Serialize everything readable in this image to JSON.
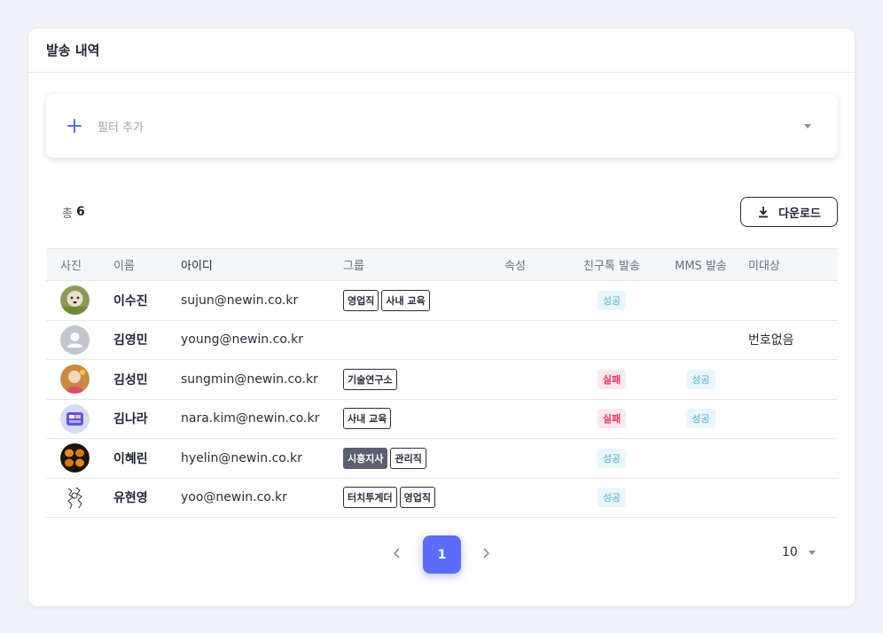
{
  "card": {
    "title": "발송 내역"
  },
  "filter": {
    "label": "필터 추가"
  },
  "summary": {
    "total_label": "총",
    "total_count": "6",
    "download_label": "다운로드"
  },
  "table": {
    "headers": {
      "photo": "사진",
      "name": "이름",
      "id": "아이디",
      "group": "그룹",
      "attr": "속성",
      "kakao": "친구톡 발송",
      "mms": "MMS 발송",
      "none": "미대상"
    },
    "rows": [
      {
        "name": "이수진",
        "id": "sujun@newin.co.kr",
        "groups": [
          "영업직",
          "사내 교육"
        ],
        "kakao": "성공",
        "mms": "",
        "none": ""
      },
      {
        "name": "김영민",
        "id": "young@newin.co.kr",
        "groups": [],
        "kakao": "",
        "mms": "",
        "none": "번호없음"
      },
      {
        "name": "김성민",
        "id": "sungmin@newin.co.kr",
        "groups": [
          "기술연구소"
        ],
        "kakao": "실패",
        "mms": "성공",
        "none": ""
      },
      {
        "name": "김나라",
        "id": "nara.kim@newin.co.kr",
        "groups": [
          "사내 교육"
        ],
        "kakao": "실패",
        "mms": "성공",
        "none": ""
      },
      {
        "name": "이혜린",
        "id": "hyelin@newin.co.kr",
        "groups": [
          "시흥지사",
          "관리직"
        ],
        "kakao": "성공",
        "mms": "",
        "none": ""
      },
      {
        "name": "유현영",
        "id": "yoo@newin.co.kr",
        "groups": [
          "터치투게더",
          "영업직"
        ],
        "kakao": "성공",
        "mms": "",
        "none": ""
      }
    ]
  },
  "pagination": {
    "current": "1",
    "page_size": "10"
  },
  "colors": {
    "accent": "#5b6cf8",
    "success": "#4fb0d4",
    "fail": "#e0365f"
  }
}
